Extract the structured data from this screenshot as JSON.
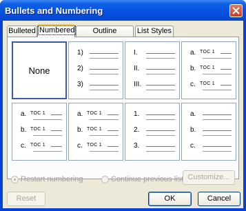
{
  "window": {
    "title": "Bullets and Numbering"
  },
  "tabs": [
    {
      "label": "Bulleted"
    },
    {
      "label": "Numbered"
    },
    {
      "label": "Outline Numbered"
    },
    {
      "label": "List Styles"
    }
  ],
  "gallery": {
    "none_label": "None",
    "cells": [
      {
        "markers": [
          "1)",
          "2)",
          "3)"
        ]
      },
      {
        "markers": [
          "I.",
          "II.",
          "III."
        ]
      },
      {
        "markers": [
          "a.",
          "b.",
          "c."
        ],
        "toc": "TOC 1"
      },
      {
        "markers": [
          "a.",
          "b.",
          "c."
        ],
        "toc": "TOC 1"
      },
      {
        "markers": [
          "a.",
          "b.",
          "c."
        ],
        "toc": "TOC 1"
      },
      {
        "markers": [
          "1.",
          "2.",
          "3."
        ]
      },
      {
        "markers": [
          "a.",
          "b.",
          "c."
        ]
      }
    ]
  },
  "options": {
    "restart_label": "Restart numbering",
    "continue_label": "Continue previous list"
  },
  "buttons": {
    "customize": "Customize...",
    "reset": "Reset",
    "ok": "OK",
    "cancel": "Cancel"
  }
}
